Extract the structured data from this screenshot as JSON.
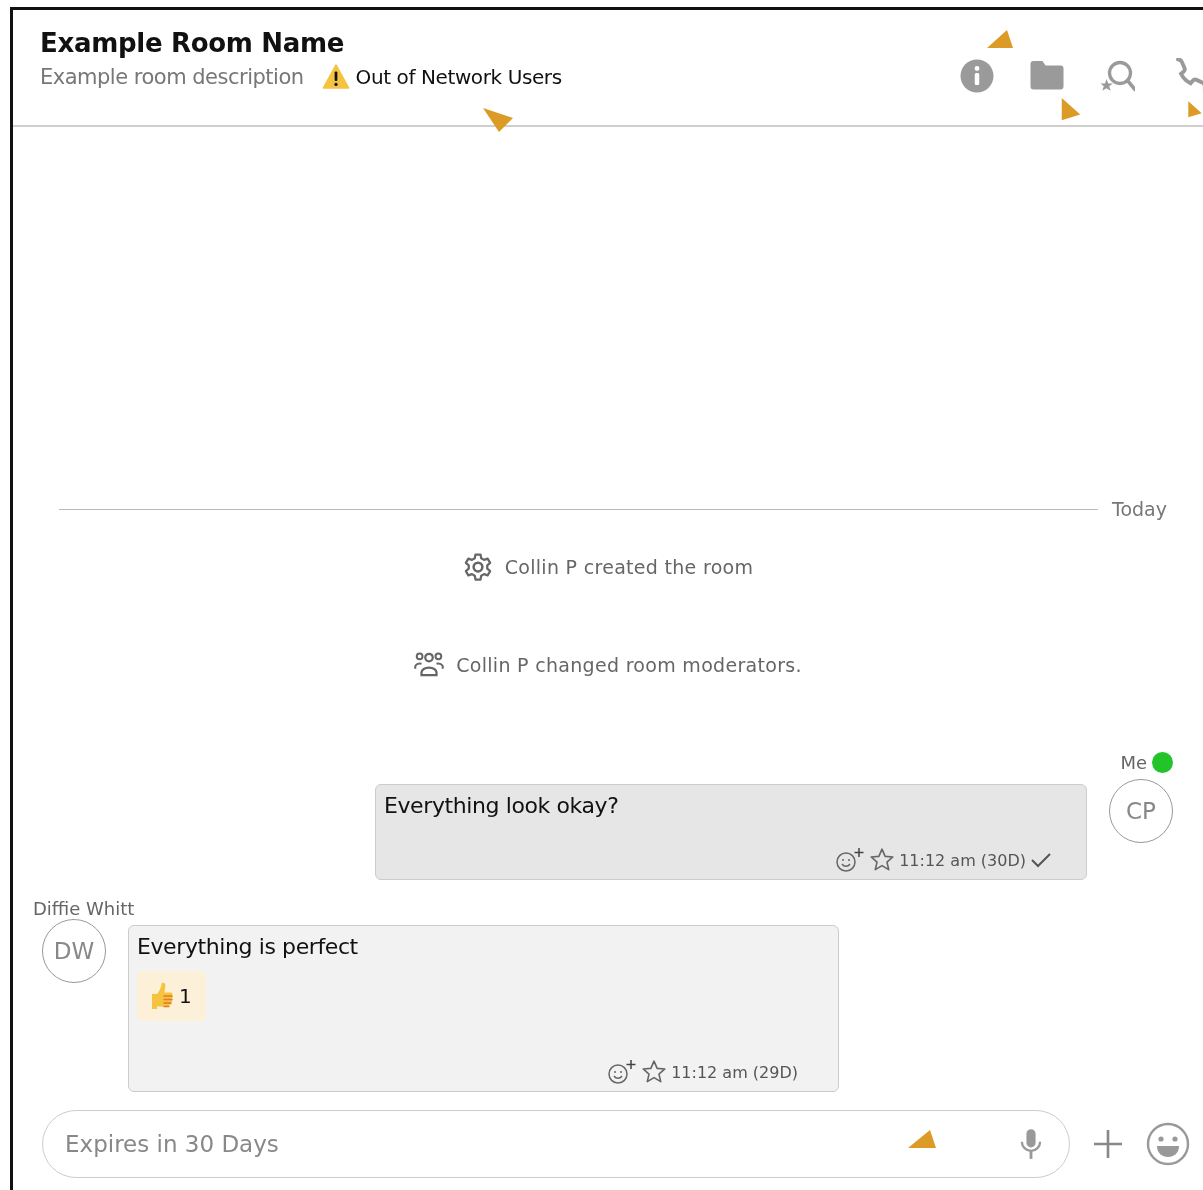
{
  "room": {
    "name": "Example Room Name",
    "description": "Example room description",
    "warning": "Out of Network Users"
  },
  "toolbar": [
    {
      "kind": "info"
    },
    {
      "kind": "folder"
    },
    {
      "kind": "search"
    },
    {
      "kind": "call"
    }
  ],
  "date_divider": "Today",
  "events": [
    {
      "kind": "settings",
      "text": "Collin P created the room"
    },
    {
      "kind": "group",
      "text": "Collin P changed room moderators."
    }
  ],
  "messages": [
    {
      "sender": "Me",
      "online": true,
      "initials": "CP",
      "outgoing": true,
      "text": "Everything look okay?",
      "time": "11:12 am (30D)",
      "delivered": true
    },
    {
      "sender": "Diffie Whitt",
      "online": false,
      "initials": "DW",
      "outgoing": false,
      "text": "Everything is perfect",
      "reactions": [
        {
          "kind": "thumbs_up",
          "count": "1"
        }
      ],
      "time": "11:12 am (29D)",
      "delivered": false
    }
  ],
  "composer": {
    "placeholder": "Expires in 30 Days"
  }
}
